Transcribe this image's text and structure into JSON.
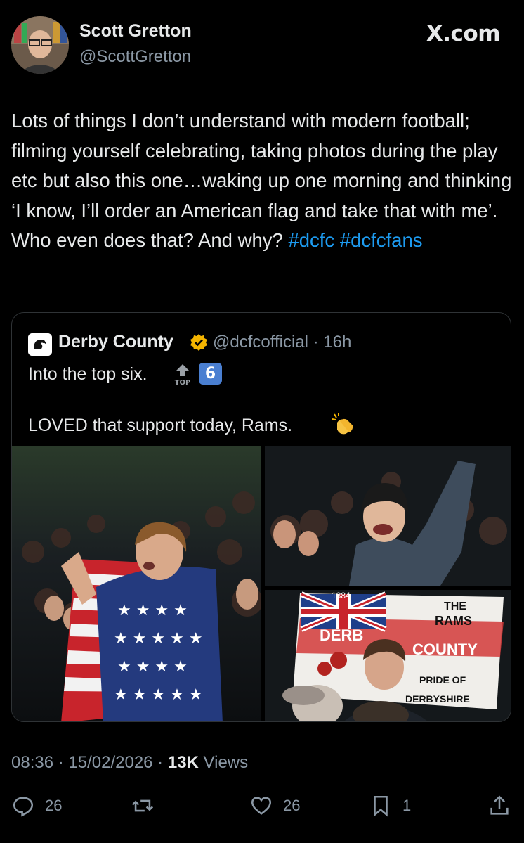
{
  "header": {
    "author_name": "Scott Gretton",
    "author_handle": "@ScottGretton",
    "site": "X.com",
    "avatar_icon": "profile-photo"
  },
  "tweet": {
    "text_plain": "Lots of things I don’t understand with modern football; filming yourself celebrating, taking photos during the play etc but also this one…waking up one morning and thinking ‘I know, I’ll order an American flag and take that with me’. Who even does that? And why? ",
    "hashtags": [
      "#dcfc",
      "#dcfcfans"
    ],
    "hashtag_color": "#1d9bf0"
  },
  "quote": {
    "name": "Derby County",
    "handle_time": "@dcfcofficial · 16h",
    "line1": "Into the top six.",
    "top_icon": "top-arrow-emoji",
    "six_label": "6",
    "line2": "LOVED that support today, Rams.",
    "clap_icon": "clapping-hands-emoji",
    "photos": [
      {
        "name": "fan-with-american-flag"
      },
      {
        "name": "fan-cheering"
      },
      {
        "name": "derby-county-flag",
        "flag_text": [
          "1884",
          "THE",
          "RAMS",
          "DERB",
          "COUNTY",
          "PRIDE OF",
          "DERBYSHIRE"
        ]
      }
    ]
  },
  "meta": {
    "time": "08:36",
    "date": "15/02/2026",
    "views_count": "13K",
    "views_label": "Views"
  },
  "actions": {
    "replies": "26",
    "likes": "26",
    "bookmarks": "1"
  },
  "colors": {
    "background": "#000000",
    "text": "#e7e9ea",
    "secondary": "#8b98a5",
    "link": "#1d9bf0",
    "verified": "#f4b400"
  }
}
